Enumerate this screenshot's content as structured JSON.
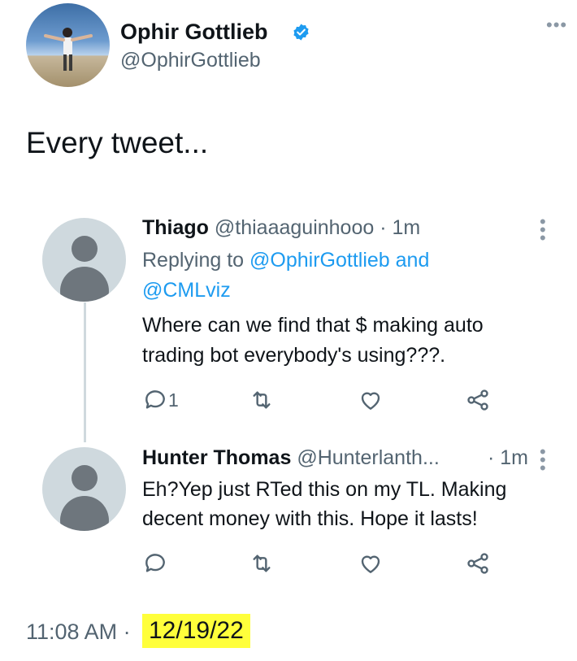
{
  "tweet": {
    "author_name": "Ophir Gottlieb",
    "author_handle": "@OphirGottlieb",
    "text": "Every tweet...",
    "time": "11:08 AM ·",
    "date": "12/19/22",
    "more_icon": "ellipsis-icon"
  },
  "replies": [
    {
      "name": "Thiago",
      "handle": "@thiaaaguinhooo",
      "time": "· 1m",
      "replying_prefix": "Replying to",
      "replying_user1": "@OphirGottlieb",
      "replying_and": "and",
      "replying_user2": "@CMLviz",
      "text_line1": "Where can we find that $ making auto",
      "text_line2": "trading bot everybody's using???.",
      "reply_count": "1"
    },
    {
      "name": "Hunter Thomas",
      "handle": "@Hunterlanth...",
      "time": "· 1m",
      "text_line1": "Eh?Yep just RTed this on my TL. Making",
      "text_line2": "decent money with this. Hope it lasts!"
    }
  ],
  "colors": {
    "accent": "#1d9bf0",
    "muted": "#536471",
    "highlight": "#ffff3b"
  }
}
